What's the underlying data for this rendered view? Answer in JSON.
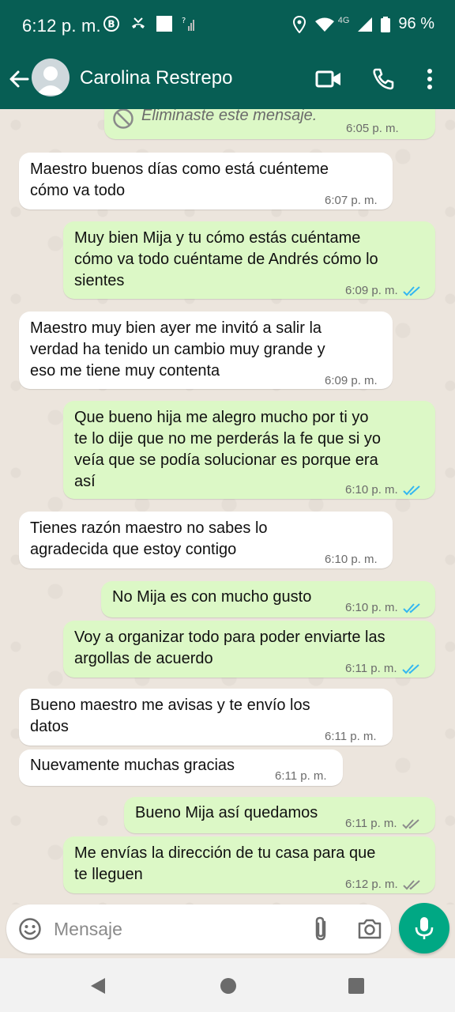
{
  "status_bar": {
    "time": "6:12 p. m.",
    "battery": "96 %",
    "network": "4G"
  },
  "header": {
    "contact_name": "Carolina Restrepo",
    "icons": [
      "back-arrow-icon",
      "avatar",
      "video-call-icon",
      "phone-call-icon",
      "more-options-icon"
    ]
  },
  "messages": [
    {
      "dir": "out",
      "deleted": true,
      "text": "Eliminaste este mensaje.",
      "time": "6:05 p. m."
    },
    {
      "dir": "in",
      "lines": [
        "Maestro buenos días como está cuénteme",
        "cómo va todo"
      ],
      "time": "6:07 p. m."
    },
    {
      "dir": "out",
      "lines": [
        "Muy bien Mija y tu cómo estás cuéntame",
        "cómo va todo cuéntame de Andrés cómo lo",
        "sientes"
      ],
      "time": "6:09 p. m.",
      "status": "read"
    },
    {
      "dir": "in",
      "lines": [
        "Maestro muy bien ayer me invitó a salir la",
        "verdad ha tenido un cambio muy grande y",
        "eso me tiene muy contenta"
      ],
      "time": "6:09 p. m."
    },
    {
      "dir": "out",
      "lines": [
        "Que bueno hija me alegro mucho por ti yo",
        "te lo dije que no me perderás la fe que si yo",
        "veía que se podía solucionar es porque era",
        "así"
      ],
      "time": "6:10 p. m.",
      "status": "read"
    },
    {
      "dir": "in",
      "lines": [
        "Tienes razón maestro no sabes lo",
        "agradecida que estoy contigo"
      ],
      "time": "6:10 p. m."
    },
    {
      "dir": "out",
      "lines": [
        "No Mija es con mucho gusto"
      ],
      "time": "6:10 p. m.",
      "status": "read"
    },
    {
      "dir": "out",
      "lines": [
        "Voy a organizar todo para poder enviarte las",
        "argollas de acuerdo"
      ],
      "time": "6:11 p. m.",
      "status": "read"
    },
    {
      "dir": "in",
      "lines": [
        "Bueno maestro me avisas y te envío los",
        "datos"
      ],
      "time": "6:11 p. m."
    },
    {
      "dir": "in",
      "lines": [
        "Nuevamente muchas gracias"
      ],
      "time": "6:11 p. m."
    },
    {
      "dir": "out",
      "lines": [
        "Bueno Mija así quedamos"
      ],
      "time": "6:11 p. m.",
      "status": "delivered"
    },
    {
      "dir": "out",
      "lines": [
        "Me envías la dirección de tu casa para que",
        "te lleguen"
      ],
      "time": "6:12 p. m.",
      "status": "delivered"
    }
  ],
  "composer": {
    "placeholder": "Mensaje",
    "icons": [
      "emoji-icon",
      "attach-icon",
      "camera-icon",
      "microphone-icon"
    ]
  },
  "colors": {
    "header": "#075e54",
    "outgoing_bubble": "#dcf8c6",
    "incoming_bubble": "#ffffff",
    "read_ticks": "#34b7f1",
    "delivered_ticks": "#8c8c8c",
    "mic_button": "#00a884"
  }
}
